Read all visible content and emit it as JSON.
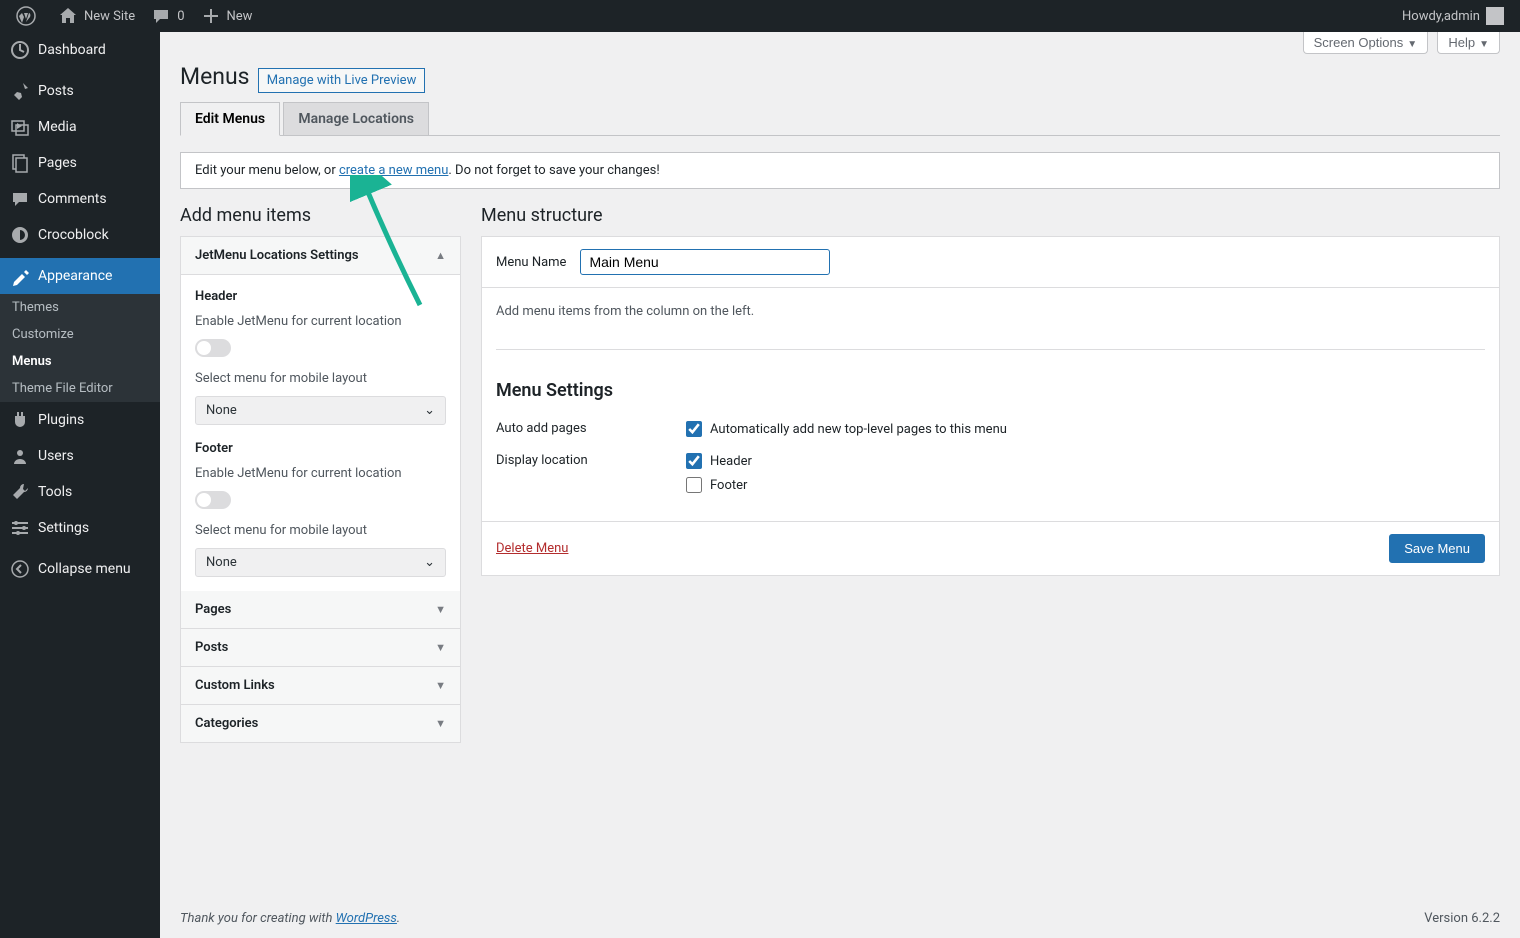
{
  "adminbar": {
    "site_name": "New Site",
    "comments_count": "0",
    "new_label": "New",
    "howdy_prefix": "Howdy, ",
    "user_name": "admin"
  },
  "adminmenu": {
    "items": [
      {
        "label": "Dashboard",
        "icon": "dashboard"
      },
      {
        "label": "Posts",
        "icon": "posts"
      },
      {
        "label": "Media",
        "icon": "media"
      },
      {
        "label": "Pages",
        "icon": "pages"
      },
      {
        "label": "Comments",
        "icon": "comments"
      },
      {
        "label": "Crocoblock",
        "icon": "crocoblock"
      },
      {
        "label": "Appearance",
        "icon": "appearance",
        "current": true
      },
      {
        "label": "Plugins",
        "icon": "plugins"
      },
      {
        "label": "Users",
        "icon": "users"
      },
      {
        "label": "Tools",
        "icon": "tools"
      },
      {
        "label": "Settings",
        "icon": "settings"
      },
      {
        "label": "Collapse menu",
        "icon": "collapse"
      }
    ],
    "appearance_sub": [
      {
        "label": "Themes"
      },
      {
        "label": "Customize"
      },
      {
        "label": "Menus",
        "current": true
      },
      {
        "label": "Theme File Editor"
      }
    ]
  },
  "screen_meta": {
    "screen_options": "Screen Options",
    "help": "Help"
  },
  "page": {
    "title": "Menus",
    "title_action": "Manage with Live Preview",
    "tabs": [
      {
        "label": "Edit Menus",
        "active": true
      },
      {
        "label": "Manage Locations"
      }
    ],
    "notice_pre": "Edit your menu below, or ",
    "notice_link": "create a new menu",
    "notice_post": ". Do not forget to save your changes!"
  },
  "add_side": {
    "heading": "Add menu items",
    "jetmenu": {
      "title": "JetMenu Locations Settings",
      "header_label": "Header",
      "footer_label": "Footer",
      "enable_label": "Enable JetMenu for current location",
      "select_label": "Select menu for mobile layout",
      "none_option": "None"
    },
    "accordions": [
      "Pages",
      "Posts",
      "Custom Links",
      "Categories"
    ]
  },
  "menu_side": {
    "heading": "Menu structure",
    "name_label": "Menu Name",
    "name_value": "Main Menu",
    "body_hint": "Add menu items from the column on the left.",
    "settings_heading": "Menu Settings",
    "auto_add_label": "Auto add pages",
    "auto_add_desc": "Automatically add new top-level pages to this menu",
    "display_loc_label": "Display location",
    "loc_header": "Header",
    "loc_footer": "Footer",
    "delete_label": "Delete Menu",
    "save_label": "Save Menu"
  },
  "footer": {
    "thanks_pre": "Thank you for creating with ",
    "thanks_link": "WordPress",
    "thanks_post": ".",
    "version": "Version 6.2.2"
  }
}
